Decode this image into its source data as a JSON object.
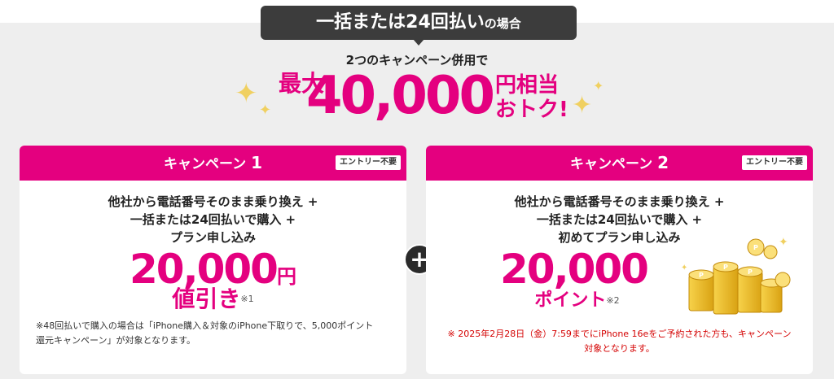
{
  "top_tab": {
    "main": "一括または24回払い",
    "small": "の場合"
  },
  "headline": {
    "note": "2つのキャンペーン併用で",
    "max": "最大",
    "amount": "40,000",
    "suffix_line1": "円相当",
    "suffix_line2": "おトク!"
  },
  "campaigns": [
    {
      "title": "キャンペーン",
      "number": "1",
      "badge": "エントリー不要",
      "conditions": [
        "他社から電話番号そのまま乗り換え +",
        "一括または24回払いで購入 +",
        "プラン申し込み"
      ],
      "amount": "20,000",
      "unit": "円",
      "benefit": "値引き",
      "marker": "※1",
      "footnote_lines": [
        "※48回払いで購入の場合は「iPhone購入＆対象のiPhone下取りで、5,000ポイント",
        "還元キャンペーン」が対象となります。"
      ]
    },
    {
      "title": "キャンペーン",
      "number": "2",
      "badge": "エントリー不要",
      "conditions": [
        "他社から電話番号そのまま乗り換え +",
        "一括または24回払いで購入 +",
        "初めてプラン申し込み"
      ],
      "amount": "20,000",
      "benefit": "ポイント",
      "marker": "※2",
      "footnote_lines": [
        "※ 2025年2月28日（金）7:59までにiPhone 16eをご予約された方も、キャンペーン",
        "対象となります。"
      ]
    }
  ],
  "plus_symbol": "+",
  "colors": {
    "accent": "#e4007f",
    "dark": "#3c3c3c",
    "background": "#eeeeee",
    "warning": "#d40000",
    "coin": "#f0c030"
  },
  "icons": {
    "sparkle": "sparkle-icon",
    "plus": "plus-icon",
    "coins": "coin-stack-icon"
  }
}
